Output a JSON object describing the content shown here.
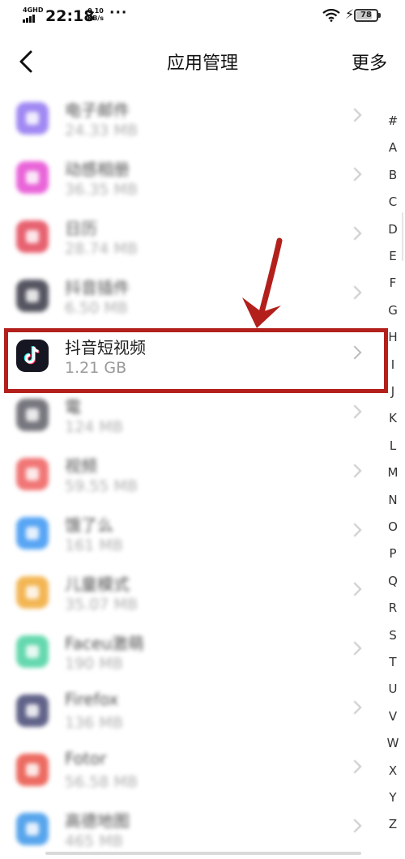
{
  "status_bar": {
    "network": "4GHD",
    "time": "22:18",
    "speed_value": "0.10",
    "speed_unit": "KB/s",
    "more_dots": "···",
    "battery": "78",
    "battery_level": 0.78,
    "icons": [
      "signal-icon",
      "wifi-icon",
      "charging-bolt-icon",
      "battery-icon"
    ]
  },
  "header": {
    "title": "应用管理",
    "more_label": "更多",
    "back_icon": "chevron-left-icon"
  },
  "apps": [
    {
      "name": "电子邮件",
      "size": "24.33 MB",
      "icon_color": "#8a6cf0"
    },
    {
      "name": "动感相册",
      "size": "36.35 MB",
      "icon_color": "#e43fd0"
    },
    {
      "name": "日历",
      "size": "28.74 MB",
      "icon_color": "#e23b4e"
    },
    {
      "name": "抖音插件",
      "size": "6.50 MB",
      "icon_color": "#2b2b3a"
    },
    {
      "name": "抖音短视频",
      "size": "1.21 GB",
      "icon_color": "#161622"
    },
    {
      "name": "電",
      "size": "124 MB",
      "icon_color": "#55555f"
    },
    {
      "name": "视频",
      "size": "59.55 MB",
      "icon_color": "#ee5454"
    },
    {
      "name": "饿了么",
      "size": "161 MB",
      "icon_color": "#2e8ff2"
    },
    {
      "name": "儿童模式",
      "size": "35.07 MB",
      "icon_color": "#f0a42a"
    },
    {
      "name": "Faceu激萌",
      "size": "190 MB",
      "icon_color": "#3fcf9a"
    },
    {
      "name": "Firefox",
      "size": "136 MB",
      "icon_color": "#3a3c6c"
    },
    {
      "name": "Fotor",
      "size": "56.58 MB",
      "icon_color": "#e8463a"
    },
    {
      "name": "高德地图",
      "size": "465 MB",
      "icon_color": "#2e8fe8"
    }
  ],
  "index_letters": [
    "#",
    "A",
    "B",
    "C",
    "D",
    "E",
    "F",
    "G",
    "H",
    "I",
    "J",
    "K",
    "L",
    "M",
    "N",
    "O",
    "P",
    "Q",
    "R",
    "S",
    "T",
    "U",
    "V",
    "W",
    "X",
    "Y",
    "Z"
  ],
  "colors": {
    "highlight": "#b3201c",
    "arrow": "#b3201c"
  }
}
